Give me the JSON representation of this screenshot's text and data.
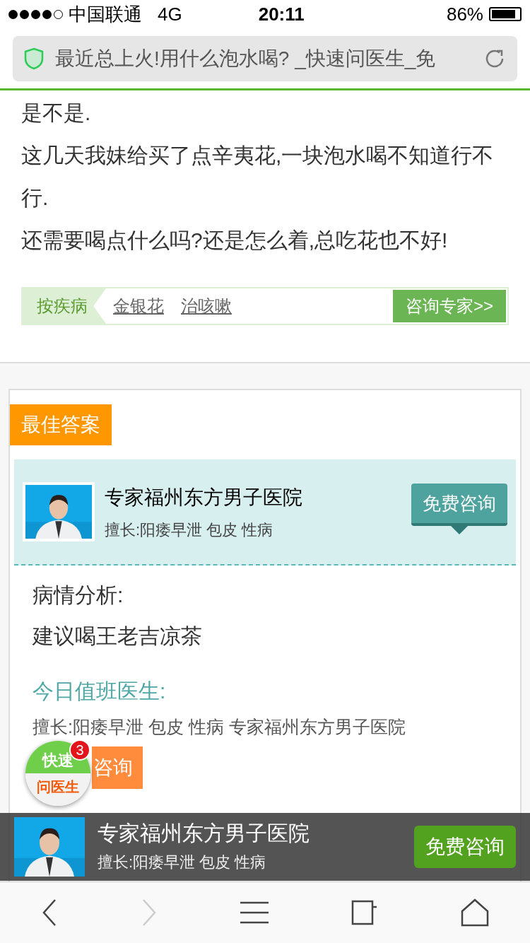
{
  "status_bar": {
    "carrier": "中国联通",
    "network": "4G",
    "time": "20:11",
    "battery": "86%"
  },
  "url_bar": {
    "title": "最近总上火!用什么泡水喝? _快速问医生_免"
  },
  "question_lines": [
    "是不是.",
    "这几天我妹给买了点辛夷花,一块泡水喝不知道行不行.",
    "还需要喝点什么吗?还是怎么着,总吃花也不好!"
  ],
  "tag_bar": {
    "label": "按疾病",
    "tags": [
      "金银花",
      "治咳嗽"
    ],
    "button": "咨询专家>>"
  },
  "answer": {
    "badge": "最佳答案",
    "doctor": {
      "name": "专家福州东方男子医院",
      "specialty": "擅长:阳痿早泄 包皮 性病",
      "button": "免费咨询"
    },
    "analysis_label": "病情分析:",
    "analysis": "建议喝王老吉凉茶",
    "duty_title": "今日值班医生:",
    "duty_text": "擅长:阳痿早泄 包皮 性病 专家福州东方男子医院",
    "duty_button": "咨询"
  },
  "floating_badge": {
    "top": "快速",
    "bottom": "问医生",
    "count": "3"
  },
  "bottom_banner": {
    "name": "专家福州东方男子医院",
    "specialty": "擅长:阳痿早泄 包皮 性病",
    "button": "免费咨询"
  },
  "toolbar": {
    "back_disabled": false,
    "forward_disabled": true
  }
}
